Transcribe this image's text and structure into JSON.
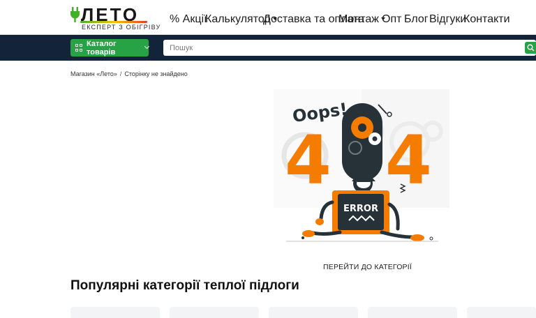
{
  "header": {
    "logo_word": "ЛЕТО",
    "logo_tagline": "ЕКСПЕРТ З ОБІГРІВУ",
    "nav": [
      {
        "label": "% Акції"
      },
      {
        "label": "Калькулятор",
        "dropdown": true
      },
      {
        "label": "Доставка та оплата"
      },
      {
        "label": "Монтаж",
        "dropdown": true
      },
      {
        "label": "Опт"
      },
      {
        "label": "Блог"
      },
      {
        "label": "Відгуки"
      },
      {
        "label": "Контакти"
      }
    ]
  },
  "toolbar": {
    "catalog_label": "Каталог товарів",
    "search_placeholder": "Пошук"
  },
  "breadcrumb": {
    "home": "Магазин «Лето»",
    "current": "Сторінку не знайдено"
  },
  "error": {
    "oops": "Oops!",
    "code_left": "4",
    "code_right": "4",
    "sign": "ERROR"
  },
  "goto_category": "ПЕРЕЙТИ ДО КАТЕГОРІЇ",
  "popular_title": "Популярні категорії теплої підлоги",
  "colors": {
    "brand_green": "#27a244",
    "bar_navy": "#13243a",
    "accent_orange": "#f57c00"
  }
}
